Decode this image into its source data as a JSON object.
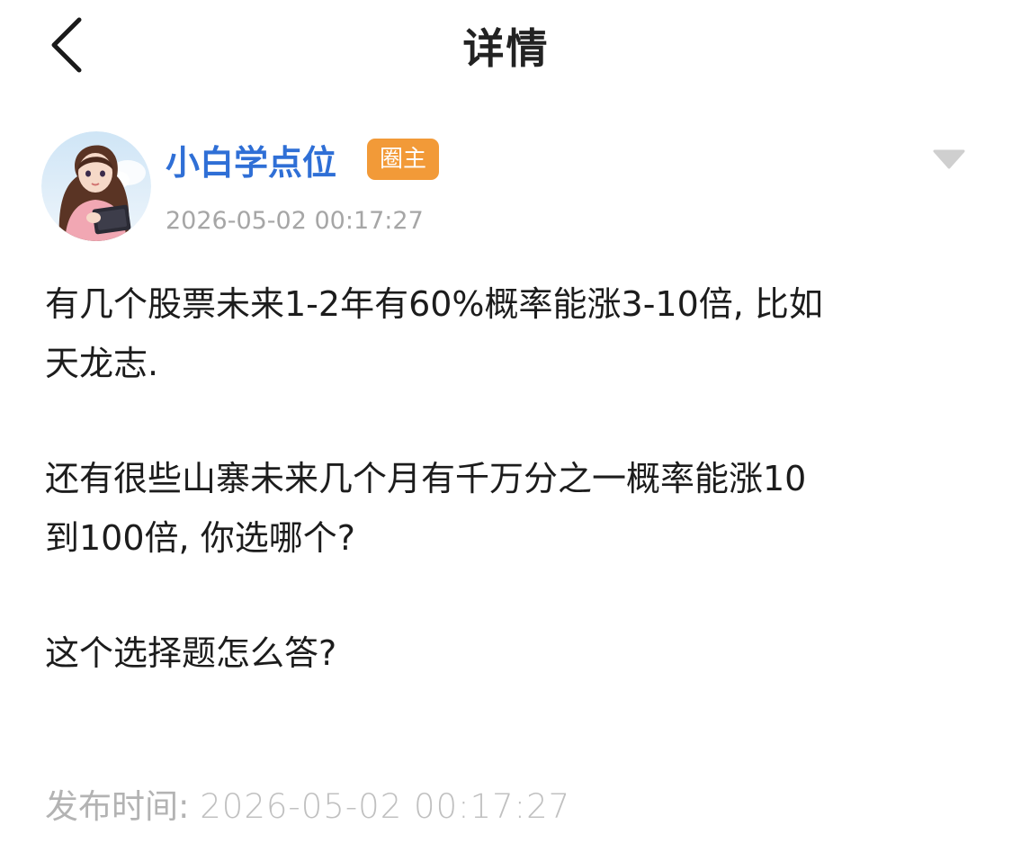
{
  "header": {
    "title": "详情",
    "back_icon": "chevron-left-icon"
  },
  "author": {
    "name": "小白学点位",
    "badge": "圈主",
    "post_time": "2026-05-02 00:17:27",
    "more_icon": "caret-down-icon"
  },
  "post": {
    "paragraphs": [
      "有几个股票未来1-2年有60%概率能涨3-10倍, 比如\n天龙志.",
      "还有很些山寨未来几个月有千万分之一概率能涨10\n到100倍, 你选哪个?",
      "这个选择题怎么答?"
    ]
  },
  "footer": {
    "publish_label": "发布时间:",
    "publish_time": "2026-05-02 00:17:27"
  },
  "colors": {
    "author_name": "#2f6fd6",
    "badge_bg": "#f29a38",
    "muted_text": "#a6a6a6"
  }
}
